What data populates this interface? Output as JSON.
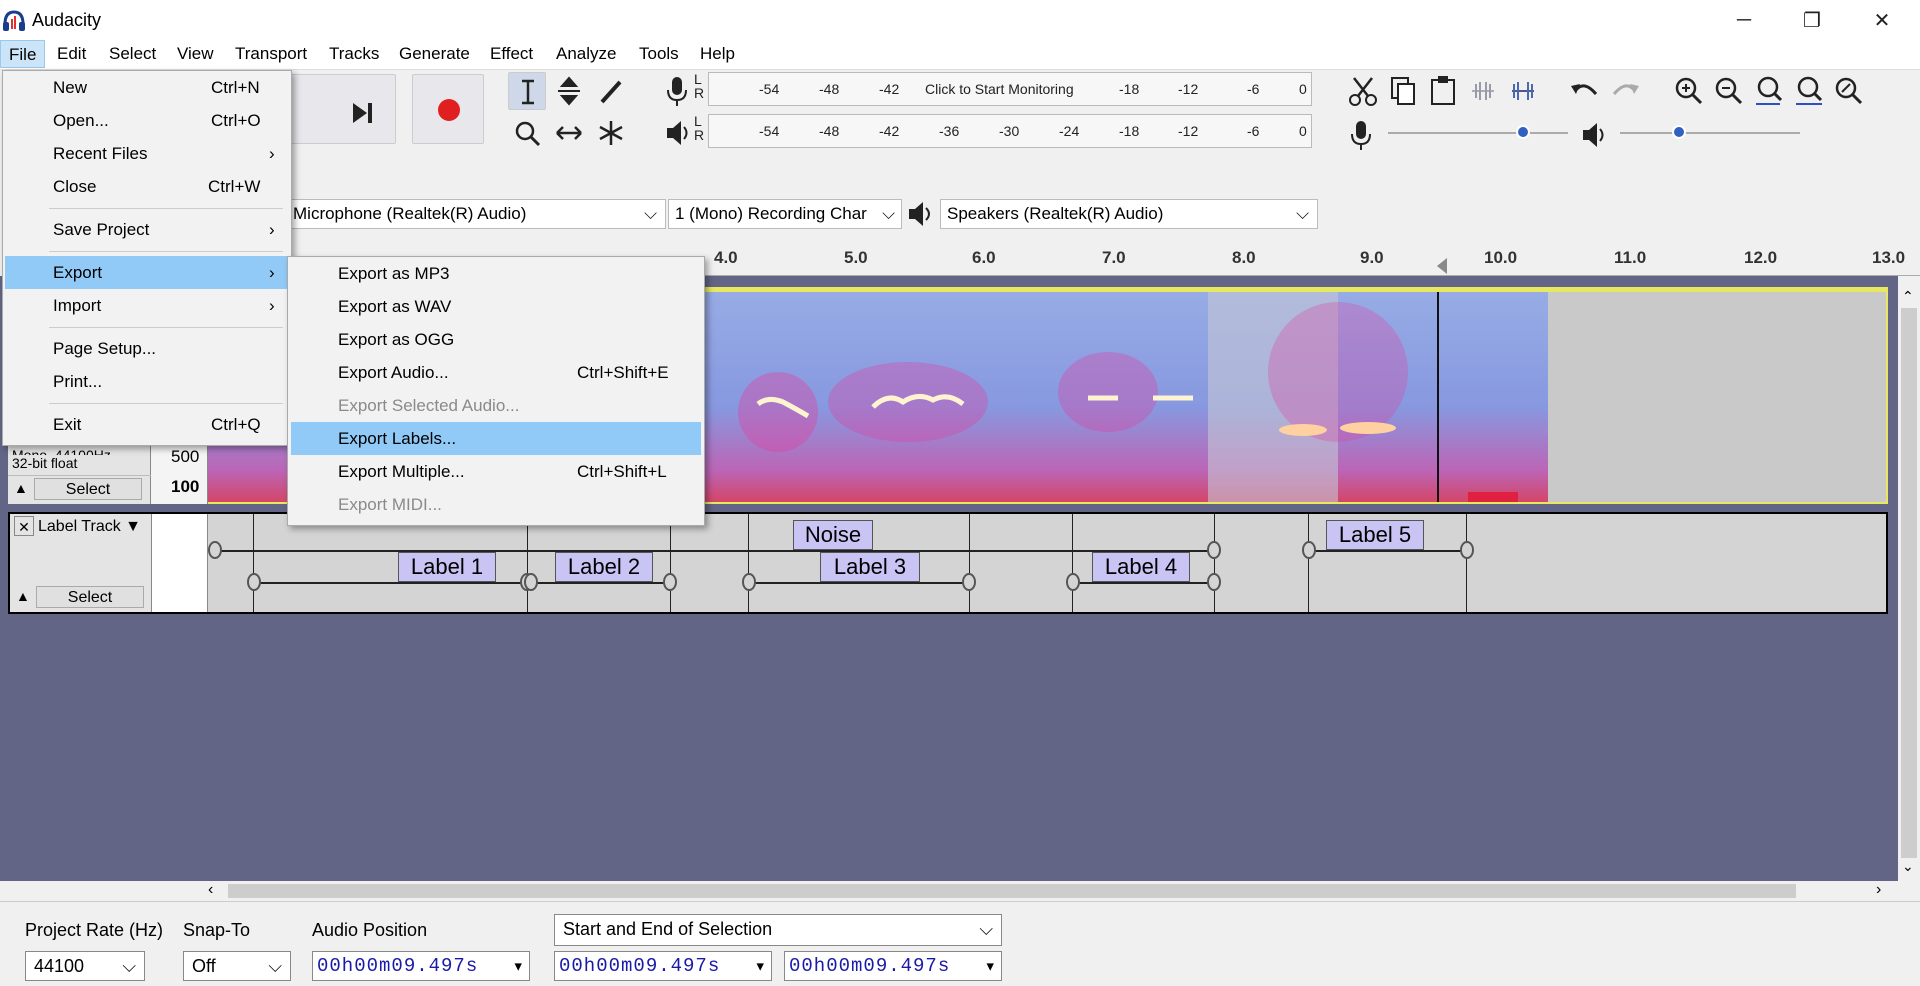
{
  "window": {
    "title": "Audacity",
    "minimize": "─",
    "restore": "❐",
    "close": "✕"
  },
  "menubar": [
    "File",
    "Edit",
    "Select",
    "View",
    "Transport",
    "Tracks",
    "Generate",
    "Effect",
    "Analyze",
    "Tools",
    "Help"
  ],
  "meters": {
    "record_ticks": [
      "-54",
      "-48",
      "-42",
      "-18",
      "-12",
      "-6",
      "0"
    ],
    "monitor_text": "Click to Start Monitoring",
    "play_ticks": [
      "-54",
      "-48",
      "-42",
      "-36",
      "-30",
      "-24",
      "-18",
      "-12",
      "-6",
      "0"
    ],
    "lr": [
      "L",
      "R"
    ]
  },
  "devices": {
    "input": "Microphone (Realtek(R) Audio)",
    "channels": "1 (Mono) Recording Char",
    "output": "Speakers (Realtek(R) Audio)"
  },
  "ruler": {
    "ticks": [
      "4.0",
      "5.0",
      "6.0",
      "7.0",
      "8.0",
      "9.0",
      "10.0",
      "11.0",
      "12.0",
      "13.0"
    ]
  },
  "audio_track": {
    "info": "Mono, 44100Hz",
    "format": "32-bit float",
    "scale": [
      "500",
      "100"
    ],
    "select": "Select"
  },
  "label_track": {
    "name": "Label Track",
    "select": "Select",
    "labels": [
      "Noise",
      "Label 5",
      "Label 1",
      "Label 2",
      "Label 3",
      "Label 4"
    ]
  },
  "file_menu": [
    {
      "label": "New",
      "shortcut": "Ctrl+N"
    },
    {
      "label": "Open...",
      "shortcut": "Ctrl+O"
    },
    {
      "label": "Recent Files",
      "shortcut": "›"
    },
    {
      "label": "Close",
      "shortcut": "Ctrl+W"
    },
    {
      "label": "Save Project",
      "shortcut": "›"
    },
    {
      "label": "Export",
      "shortcut": "›"
    },
    {
      "label": "Import",
      "shortcut": "›"
    },
    {
      "label": "Page Setup...",
      "shortcut": ""
    },
    {
      "label": "Print...",
      "shortcut": ""
    },
    {
      "label": "Exit",
      "shortcut": "Ctrl+Q"
    }
  ],
  "export_menu": [
    {
      "label": "Export as MP3",
      "shortcut": ""
    },
    {
      "label": "Export as WAV",
      "shortcut": ""
    },
    {
      "label": "Export as OGG",
      "shortcut": ""
    },
    {
      "label": "Export Audio...",
      "shortcut": "Ctrl+Shift+E"
    },
    {
      "label": "Export Selected Audio...",
      "shortcut": ""
    },
    {
      "label": "Export Labels...",
      "shortcut": ""
    },
    {
      "label": "Export Multiple...",
      "shortcut": "Ctrl+Shift+L"
    },
    {
      "label": "Export MIDI...",
      "shortcut": ""
    }
  ],
  "status": {
    "rate_label": "Project Rate (Hz)",
    "rate_value": "44100",
    "snap_label": "Snap-To",
    "snap_value": "Off",
    "pos_label": "Audio Position",
    "pos_value": "00h00m09.497s",
    "sel_mode": "Start and End of Selection",
    "sel_start": "00h00m09.497s",
    "sel_end": "00h00m09.497s"
  }
}
